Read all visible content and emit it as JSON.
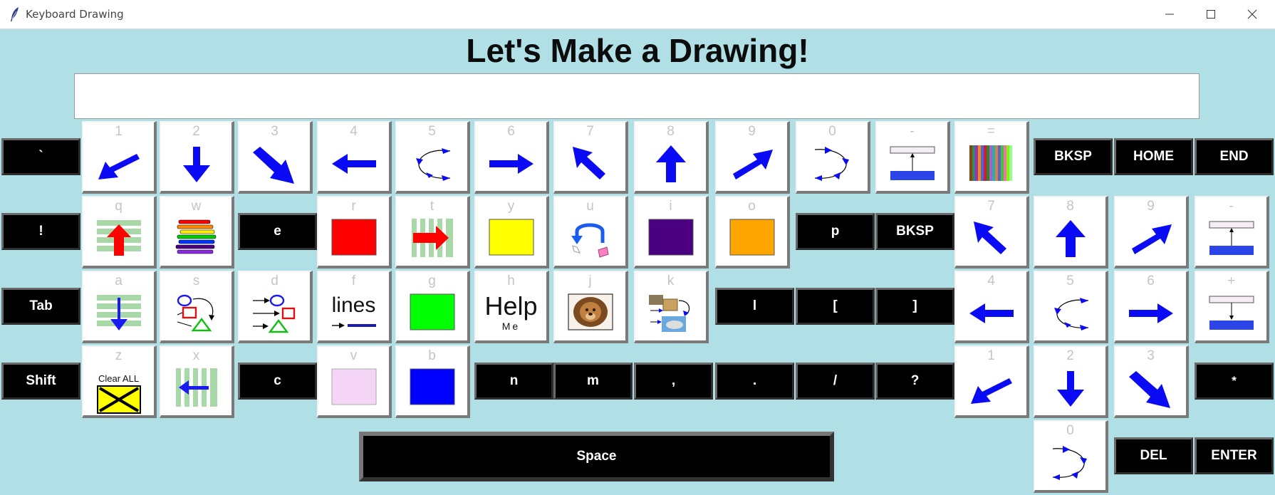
{
  "window": {
    "title": "Keyboard Drawing"
  },
  "heading": "Let's Make a Drawing!",
  "entry": {
    "value": ""
  },
  "colors": {
    "background": "#b0dfe5",
    "arrow": "#0a0af5",
    "red": "#ff0000",
    "yellow": "#ffff00",
    "purple": "#4b0082",
    "orange": "#ffa500",
    "green": "#00ff00",
    "pink": "#f5d5f5",
    "blue": "#0000ff",
    "stripe": "#a8d8a8"
  },
  "keys": {
    "backtick": "`",
    "bang": "!",
    "tab": "Tab",
    "shift": "Shift",
    "bksp_top": "BKSP",
    "home": "HOME",
    "end": "END",
    "e": "e",
    "p": "p",
    "bksp_mid": "BKSP",
    "l": "l",
    "lbracket": "[",
    "rbracket": "]",
    "c": "c",
    "n": "n",
    "m": "m",
    "comma": ",",
    "period": ".",
    "slash": "/",
    "question": "?",
    "star": "*",
    "space": "Space",
    "del": "DEL",
    "enter": "ENTER"
  },
  "captions": {
    "k1": "1",
    "k2": "2",
    "k3": "3",
    "k4": "4",
    "k5": "5",
    "k6": "6",
    "k7": "7",
    "k8": "8",
    "k9": "9",
    "k0": "0",
    "kminus": "-",
    "kequals": "=",
    "q": "q",
    "w": "w",
    "r": "r",
    "t": "t",
    "y": "y",
    "u": "u",
    "i": "i",
    "o": "o",
    "a": "a",
    "s": "s",
    "d": "d",
    "f": "f",
    "g": "g",
    "h": "h",
    "j": "j",
    "k": "k",
    "z": "z",
    "x": "x",
    "v": "v",
    "b": "b",
    "n7": "7",
    "n8": "8",
    "n9": "9",
    "nminus": "-",
    "n4": "4",
    "n5": "5",
    "n6": "6",
    "nplus": "+",
    "n1": "1",
    "n2": "2",
    "n3": "3",
    "n0": "0"
  },
  "labels": {
    "lines": "lines",
    "help": "Help",
    "me": "Me",
    "clear_all": "Clear ALL"
  }
}
